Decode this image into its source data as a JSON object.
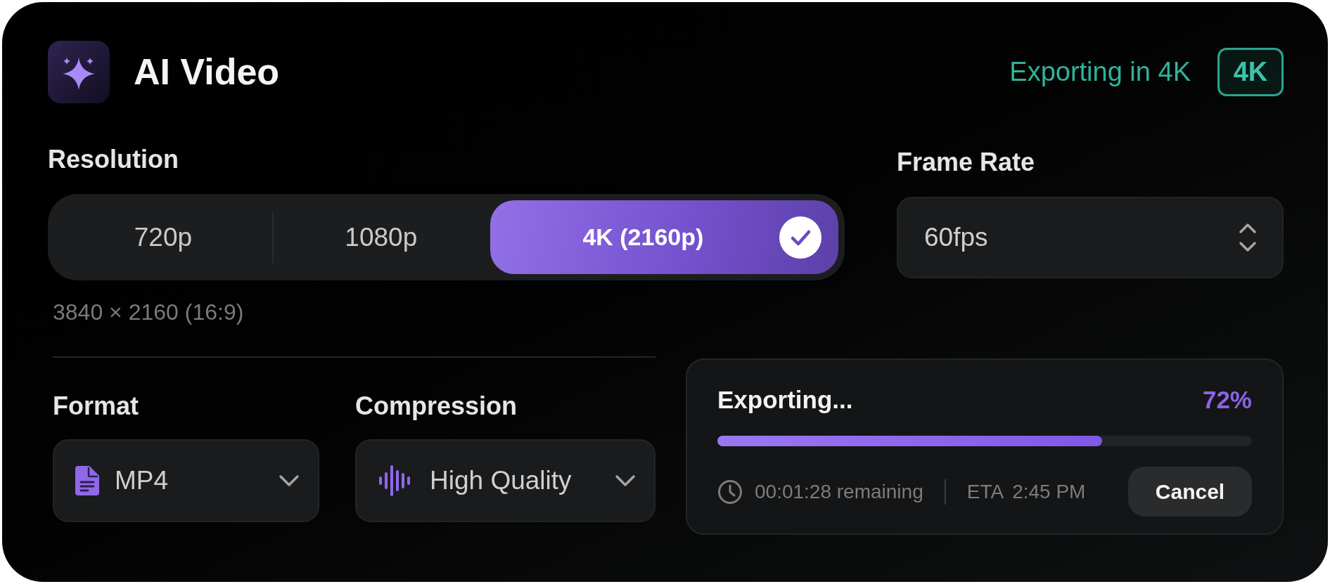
{
  "app": {
    "title": "AI Video"
  },
  "export_status": {
    "label": "Exporting in 4K",
    "badge": "4K"
  },
  "resolution": {
    "label": "Resolution",
    "options": [
      {
        "label": "720p",
        "selected": false
      },
      {
        "label": "1080p",
        "selected": false
      },
      {
        "label": "4K (2160p)",
        "selected": true
      }
    ],
    "caption": "3840 × 2160 (16:9)"
  },
  "frame_rate": {
    "label": "Frame Rate",
    "value": "60fps"
  },
  "format": {
    "label": "Format",
    "value": "MP4"
  },
  "compression": {
    "label": "Compression",
    "value": "High Quality"
  },
  "progress": {
    "title": "Exporting...",
    "percent": "72%",
    "level": 0.72,
    "remaining": "00:01:28 remaining",
    "eta_label": "ETA",
    "eta_time": "2:45 PM",
    "cancel": "Cancel"
  }
}
